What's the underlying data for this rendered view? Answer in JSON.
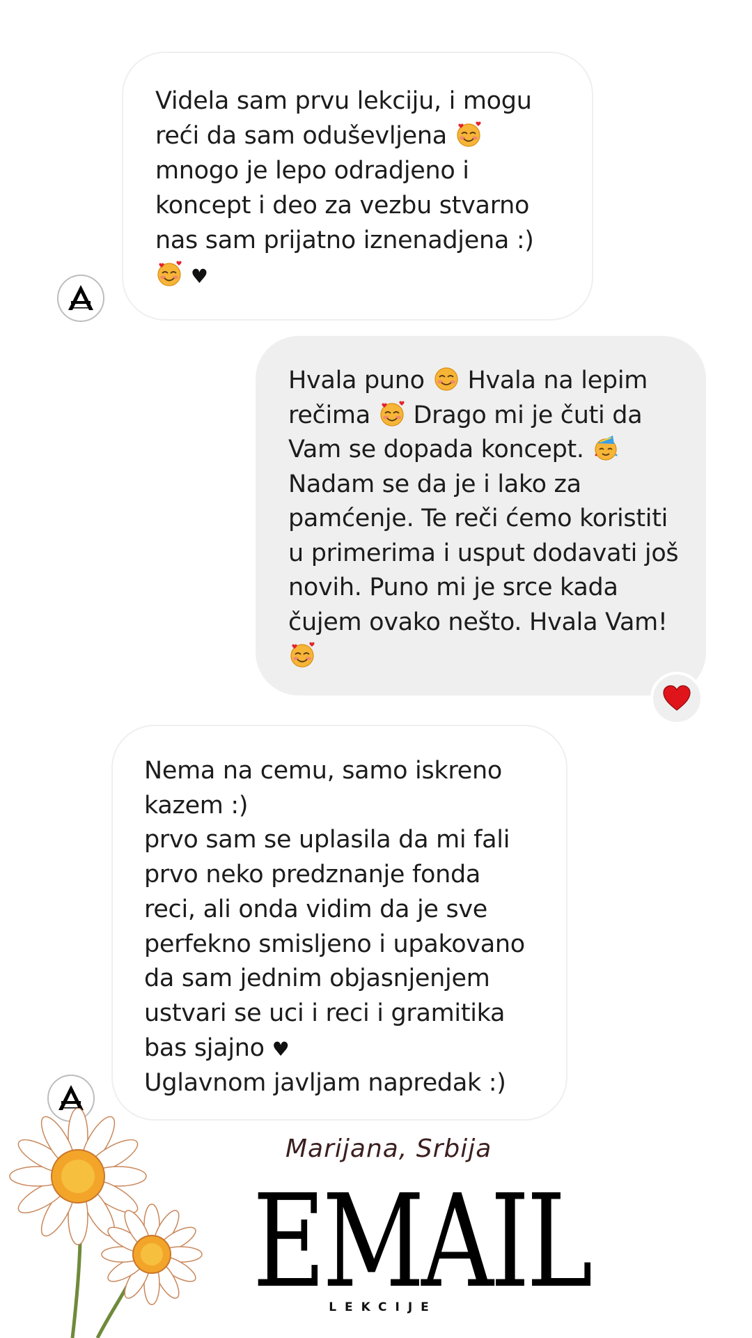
{
  "messages": [
    {
      "lines": [
        "Videla sam prvu lekciju, i mogu",
        "reći da sam oduševljena",
        "mnogo je lepo odradjeno i",
        "koncept i deo za vezbu stvarno",
        "nas sam prijatno iznenadjena :)"
      ]
    },
    {
      "lines": [
        "Hvala puno",
        "Hvala na lepim",
        "rečima",
        "Drago mi je čuti da",
        "Vam se dopada koncept.",
        "Nadam se da je i lako za",
        "pamćenje. Te reči ćemo koristiti",
        "u primerima i usput dodavati još",
        "novih. Puno mi je srce kada",
        "čujem ovako nešto. Hvala Vam!"
      ]
    },
    {
      "lines": [
        "Nema na cemu, samo iskreno",
        "kazem :)",
        "prvo sam se uplasila da mi fali",
        "prvo neko predznanje fonda",
        "reci, ali onda vidim da je sve",
        "perfekno smisljeno i upakovano",
        "da sam jednim objasnjenjem",
        "ustvari se uci i reci i gramitika",
        "bas sjajno",
        "Uglavnom javljam napredak :)"
      ]
    }
  ],
  "signature": "Marijana, Srbija",
  "brand": {
    "name": "EMAIL",
    "subtitle": "LEKCIJE"
  },
  "icons": {
    "avatar": "logo-a-icon",
    "reaction": "red-heart-icon",
    "emoji_love": "smiling-face-with-hearts-icon",
    "emoji_smile": "smiling-face-icon",
    "emoji_party": "partying-face-icon",
    "heart": "black-heart-icon",
    "decoration": "chamomile-flowers"
  },
  "colors": {
    "incoming_bubble": "#ffffff",
    "outgoing_bubble": "#efefef",
    "reaction_heart": "#e0151b",
    "signature_text": "#3b1f1f"
  }
}
